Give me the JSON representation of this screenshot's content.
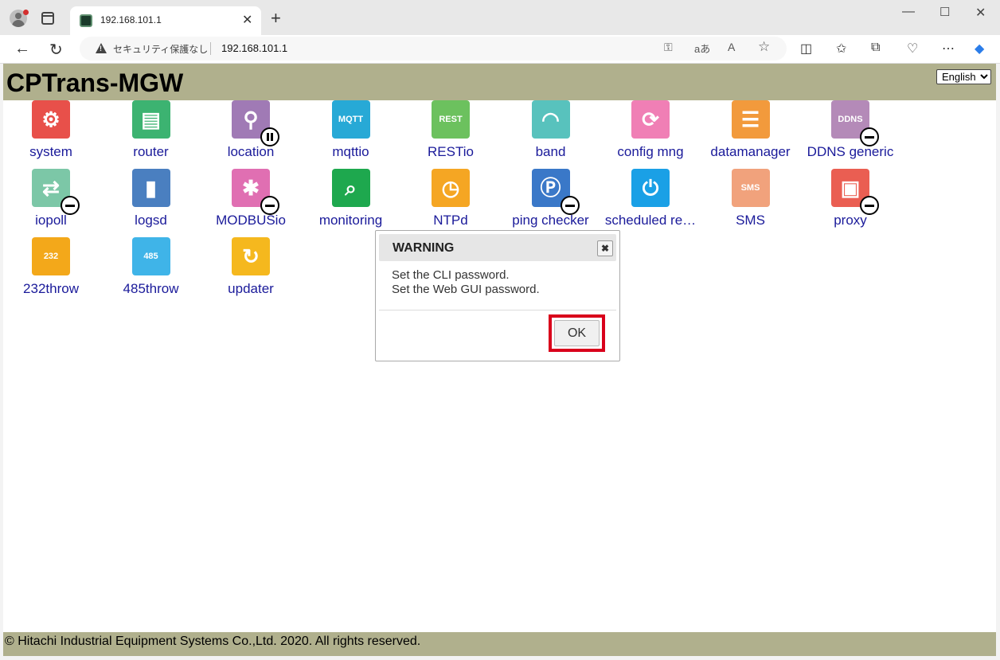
{
  "browser": {
    "tab_title": "192.168.101.1",
    "security_label": "セキュリティ保護なし",
    "url": "192.168.101.1"
  },
  "page": {
    "brand": "CPTrans-MGW",
    "language": {
      "selected": "English"
    },
    "apps": [
      {
        "label": "system",
        "icon": "gear-icon",
        "color": "#e8504a",
        "glyph": "⚙",
        "status": ""
      },
      {
        "label": "router",
        "icon": "router-icon",
        "color": "#3cb371",
        "glyph": "▤",
        "status": ""
      },
      {
        "label": "location",
        "icon": "location-pin-icon",
        "color": "#a07ab5",
        "glyph": "⚲",
        "status": "paused"
      },
      {
        "label": "mqttio",
        "icon": "mqtt-icon",
        "color": "#27a9d6",
        "glyph": "MQTT",
        "status": ""
      },
      {
        "label": "RESTio",
        "icon": "rest-cloud-icon",
        "color": "#6cc15e",
        "glyph": "REST",
        "status": ""
      },
      {
        "label": "band",
        "icon": "wifi-icon",
        "color": "#58c2bd",
        "glyph": "◠",
        "status": ""
      },
      {
        "label": "config mng",
        "icon": "config-gear-icon",
        "color": "#f07fb5",
        "glyph": "⟳",
        "status": ""
      },
      {
        "label": "datamanager",
        "icon": "database-icon",
        "color": "#f29a3c",
        "glyph": "☰",
        "status": ""
      },
      {
        "label": "DDNS generic",
        "icon": "ddns-cloud-icon",
        "color": "#b48ab8",
        "glyph": "DDNS",
        "status": "stopped"
      },
      {
        "label": "iopoll",
        "icon": "exchange-arrows-icon",
        "color": "#7cc7a7",
        "glyph": "⇄",
        "status": "stopped"
      },
      {
        "label": "logsd",
        "icon": "log-book-icon",
        "color": "#4a7fc0",
        "glyph": "▮",
        "status": ""
      },
      {
        "label": "MODBUSio",
        "icon": "network-hub-icon",
        "color": "#e06fb2",
        "glyph": "✱",
        "status": "stopped"
      },
      {
        "label": "monitoring",
        "icon": "monitoring-icon",
        "color": "#1ea84e",
        "glyph": "⌕",
        "status": ""
      },
      {
        "label": "NTPd",
        "icon": "clock-icon",
        "color": "#f5a623",
        "glyph": "◷",
        "status": ""
      },
      {
        "label": "ping checker",
        "icon": "ping-icon",
        "color": "#3a78c8",
        "glyph": "Ⓟ",
        "status": "stopped"
      },
      {
        "label": "scheduled re…",
        "icon": "power-icon",
        "color": "#1aa0e6",
        "glyph": "⏻",
        "status": ""
      },
      {
        "label": "SMS",
        "icon": "sms-icon",
        "color": "#f1a27c",
        "glyph": "SMS",
        "status": ""
      },
      {
        "label": "proxy",
        "icon": "proxy-icon",
        "color": "#ea5e52",
        "glyph": "▣",
        "status": "stopped"
      },
      {
        "label": "232throw",
        "icon": "serial-232-icon",
        "color": "#f3a81a",
        "glyph": "232",
        "status": ""
      },
      {
        "label": "485throw",
        "icon": "serial-485-icon",
        "color": "#3fb4e8",
        "glyph": "485",
        "status": ""
      },
      {
        "label": "updater",
        "icon": "refresh-icon",
        "color": "#f5b81e",
        "glyph": "↻",
        "status": ""
      }
    ],
    "footer": "© Hitachi Industrial Equipment Systems Co.,Ltd. 2020. All rights reserved."
  },
  "dialog": {
    "title": "WARNING",
    "close_glyph": "✖",
    "lines": [
      "Set the CLI password.",
      "Set the Web GUI password."
    ],
    "ok_label": "OK",
    "highlight_color": "#d9001b"
  }
}
